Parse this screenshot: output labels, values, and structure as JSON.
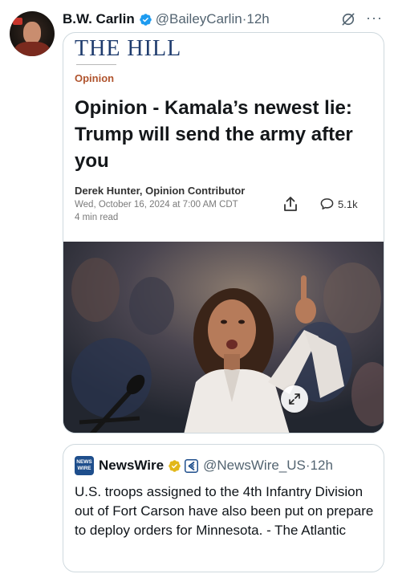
{
  "post": {
    "author_name": "B.W. Carlin",
    "handle": "@BaileyCarlin",
    "separator": "·",
    "time": "12h"
  },
  "icons": {
    "verified": "verified-badge-icon",
    "grok": "grok-icon",
    "more": "more-options-icon",
    "share": "share-icon",
    "comment": "comment-bubble-icon",
    "expand": "expand-icon"
  },
  "article": {
    "masthead": "THE HILL",
    "section": "Opinion",
    "headline": "Opinion - Kamala’s newest lie: Trump will send the army after you",
    "author": "Derek Hunter, Opinion Contributor",
    "date": "Wed, October 16, 2024 at 7:00 AM CDT",
    "read_time": "4 min read",
    "comment_count": "5.1k"
  },
  "quote": {
    "avatar_text": "NEWS WIRE",
    "name": "NewsWire",
    "handle": "@NewsWire_US",
    "separator": "·",
    "time": "12h",
    "text": "U.S. troops assigned to the 4th Infantry Division out of Fort Carson have also been put on prepare to deploy orders for Minnesota. - The Atlantic"
  },
  "colors": {
    "verified_blue": "#1d9bf0",
    "verified_gold": "#e2b719",
    "masthead_navy": "#1f3c6e",
    "section_orange": "#b0542e"
  },
  "more_glyph": "···"
}
